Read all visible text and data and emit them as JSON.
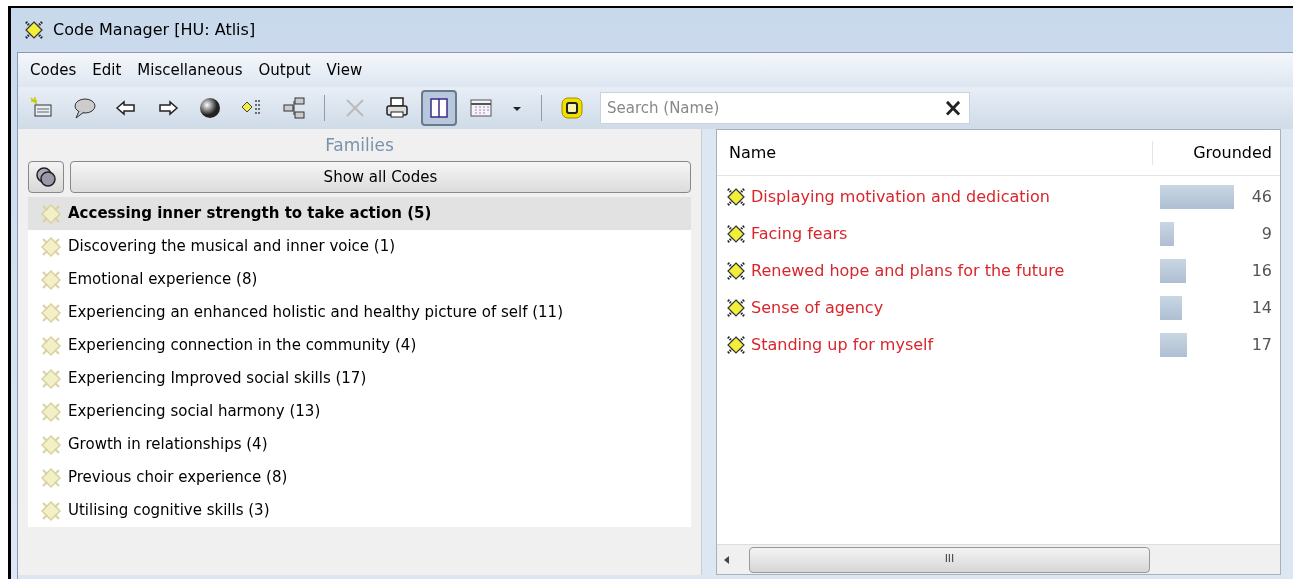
{
  "window": {
    "title": "Code Manager [HU: Atlis]"
  },
  "menu": [
    "Codes",
    "Edit",
    "Miscellaneous",
    "Output",
    "View"
  ],
  "toolbar": [
    [
      {
        "kind": "new",
        "selected": false
      },
      {
        "kind": "comment",
        "selected": false
      },
      {
        "kind": "back",
        "selected": false
      },
      {
        "kind": "forward",
        "selected": false
      },
      {
        "kind": "sphere",
        "selected": false
      },
      {
        "kind": "list",
        "selected": false
      },
      {
        "kind": "tree",
        "selected": false
      }
    ],
    [
      {
        "kind": "delete",
        "selected": false
      },
      {
        "kind": "print",
        "selected": false
      },
      {
        "kind": "split",
        "selected": true
      },
      {
        "kind": "grid",
        "selected": false
      },
      {
        "kind": "caret",
        "selected": false
      }
    ],
    [
      {
        "kind": "filter",
        "selected": false
      }
    ]
  ],
  "search": {
    "placeholder": "Search (Name)",
    "clear": "×"
  },
  "families": {
    "title": "Families",
    "show_all": "Show all Codes",
    "items": [
      {
        "label": "Accessing inner strength to take action (5)",
        "selected": true
      },
      {
        "label": "Discovering the musical and inner voice (1)",
        "selected": false
      },
      {
        "label": "Emotional experience (8)",
        "selected": false
      },
      {
        "label": "Experiencing an enhanced holistic and healthy picture of self (11)",
        "selected": false
      },
      {
        "label": "Experiencing connection in the community (4)",
        "selected": false
      },
      {
        "label": "Experiencing Improved social skills (17)",
        "selected": false
      },
      {
        "label": "Experiencing social harmony (13)",
        "selected": false
      },
      {
        "label": "Growth in relationships (4)",
        "selected": false
      },
      {
        "label": "Previous choir experience (8)",
        "selected": false
      },
      {
        "label": "Utilising cognitive skills (3)",
        "selected": false
      }
    ]
  },
  "codes": {
    "columns": [
      "Name",
      "Grounded"
    ],
    "rows": [
      {
        "name": "Displaying motivation and dedication",
        "grounded": "46"
      },
      {
        "name": "Facing fears",
        "grounded": "9"
      },
      {
        "name": "Renewed hope and plans for the future",
        "grounded": "16"
      },
      {
        "name": "Sense of agency",
        "grounded": "14"
      },
      {
        "name": "Standing up for myself",
        "grounded": "17"
      }
    ],
    "scrollbar_grip": "III"
  }
}
